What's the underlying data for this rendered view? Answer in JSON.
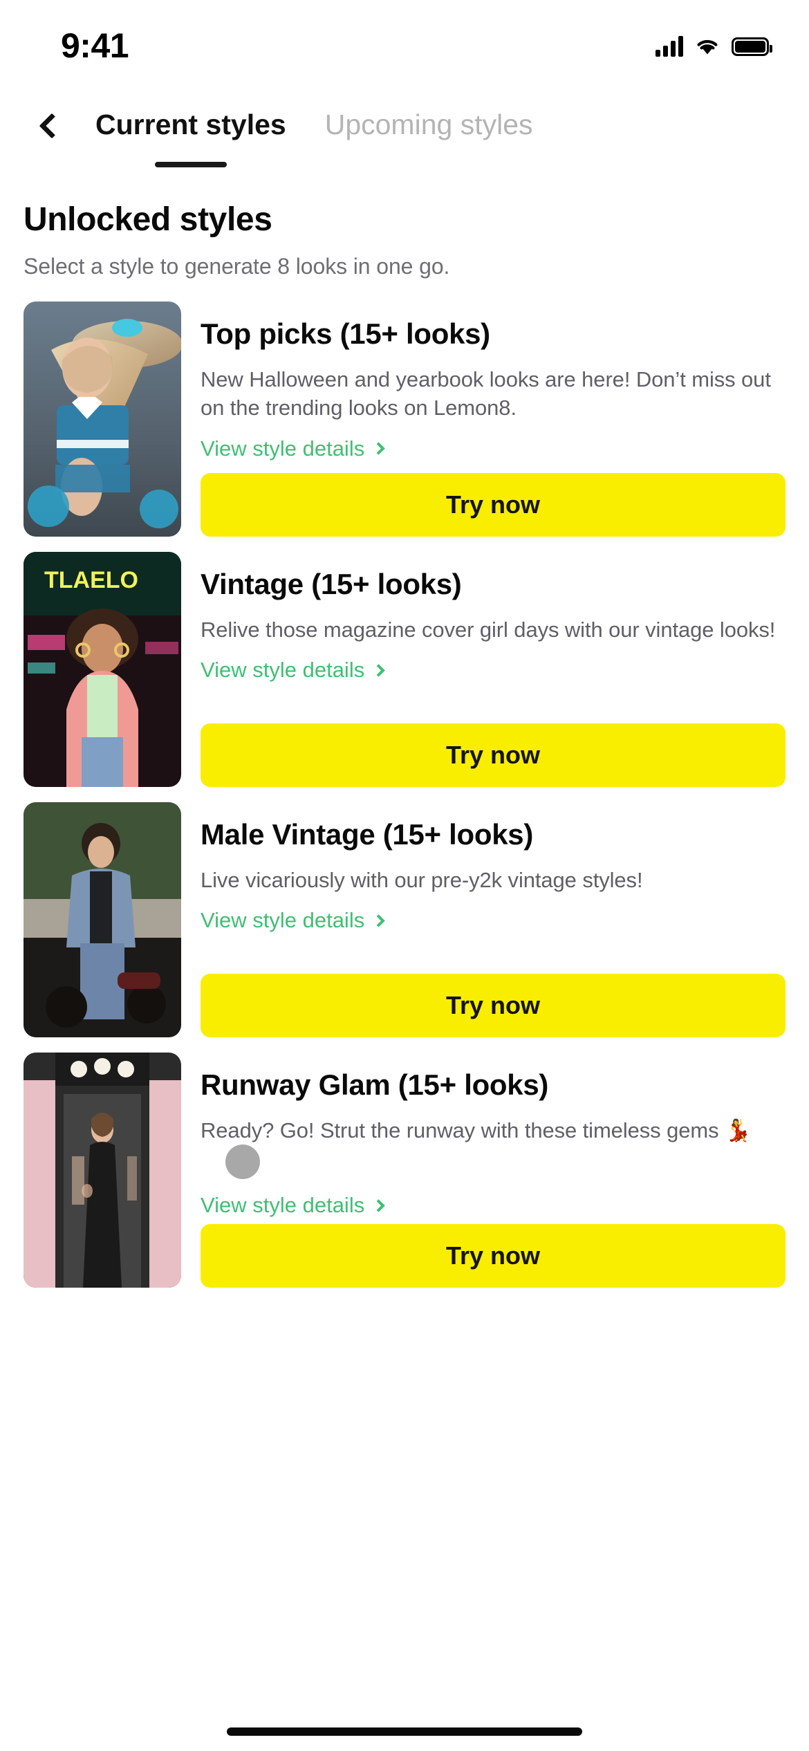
{
  "status_bar": {
    "time": "9:41",
    "icons": [
      "cellular-signal-icon",
      "wifi-icon",
      "battery-icon"
    ]
  },
  "nav": {
    "back_icon": "chevron-left-icon",
    "tabs": [
      {
        "label": "Current styles",
        "active": true
      },
      {
        "label": "Upcoming styles",
        "active": false
      }
    ]
  },
  "section": {
    "title": "Unlocked styles",
    "subtitle": "Select a style to generate 8 looks in one go."
  },
  "colors": {
    "cta_yellow": "#FAEE00",
    "link_green": "#3FBF73",
    "text_primary": "#0A0A0A",
    "text_secondary": "#5F5F66",
    "tab_inactive": "#B4B4B4"
  },
  "common": {
    "detail_link_label": "View style details",
    "detail_link_arrow_icon": "chevron-right-icon",
    "cta_label": "Try now"
  },
  "cards": [
    {
      "title": "Top picks (15+ looks)",
      "description": "New Halloween and yearbook looks are here! Don’t miss out on the trending looks on Lemon8.",
      "detail_link": "View style details",
      "cta": "Try now",
      "thumb_name": "thumbnail-top-picks"
    },
    {
      "title": "Vintage (15+ looks)",
      "description": "Relive those magazine cover girl days with our vintage looks!",
      "detail_link": "View style details",
      "cta": "Try now",
      "thumb_name": "thumbnail-vintage"
    },
    {
      "title": "Male Vintage (15+ looks)",
      "description": "Live vicariously with our pre-y2k vintage styles!",
      "detail_link": "View style details",
      "cta": "Try now",
      "thumb_name": "thumbnail-male-vintage"
    },
    {
      "title": "Runway Glam (15+ looks)",
      "description": "Ready? Go! Strut the runway with these timeless gems 💃",
      "detail_link": "View style details",
      "cta": "Try now",
      "thumb_name": "thumbnail-runway-glam"
    }
  ]
}
